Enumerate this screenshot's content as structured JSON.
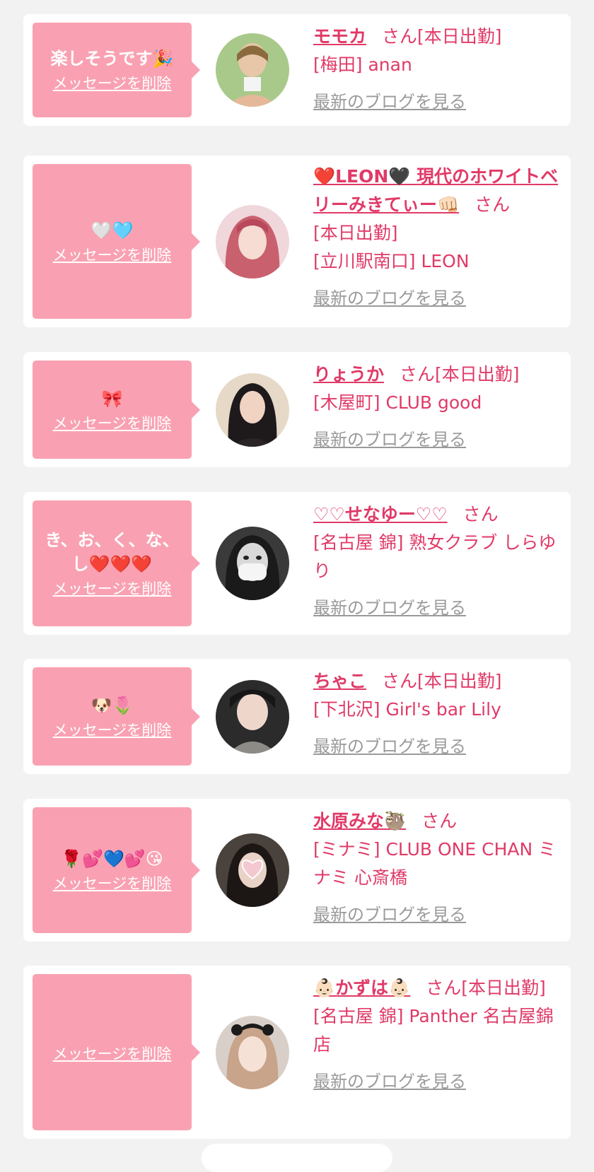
{
  "common": {
    "delete_label": "メッセージを削除",
    "blog_label": "最新のブログを見る",
    "san_suffix": "さん"
  },
  "cards": [
    {
      "message": "楽しそうです🎉",
      "name": "モモカ",
      "status": "[本日出勤]",
      "shop": "[梅田] anan"
    },
    {
      "message": "🤍🩵",
      "name": "❤️LEON🖤 現代のホワイトベリーみきてぃー👊🏻",
      "status": "[本日出勤]",
      "shop": "[立川駅南口] LEON"
    },
    {
      "message": "🎀",
      "name": "りょうか",
      "status": "[本日出勤]",
      "shop": "[木屋町] CLUB good"
    },
    {
      "message": "き、お、く、な、し❤️❤️❤️",
      "name": "♡♡せなゆー♡♡",
      "status": "",
      "shop": "[名古屋 錦] 熟女クラブ しらゆり"
    },
    {
      "message": "🐶🌷",
      "name": "ちゃこ",
      "status": "[本日出勤]",
      "shop": "[下北沢] Girl's bar Lily"
    },
    {
      "message": "🌹💕💙💕😘",
      "name": "水原みな🦥",
      "status": "",
      "shop": "[ミナミ] CLUB ONE CHAN ミナミ 心斎橋"
    },
    {
      "message": "",
      "name": "👶🏻かずは👶🏻",
      "status": "[本日出勤]",
      "shop": "[名古屋 錦] Panther 名古屋錦店"
    }
  ],
  "colors": {
    "bubble": "#f9a1b2",
    "accent": "#e03a67",
    "blog_link": "#9a9a9a",
    "background": "#f2f2f2"
  }
}
